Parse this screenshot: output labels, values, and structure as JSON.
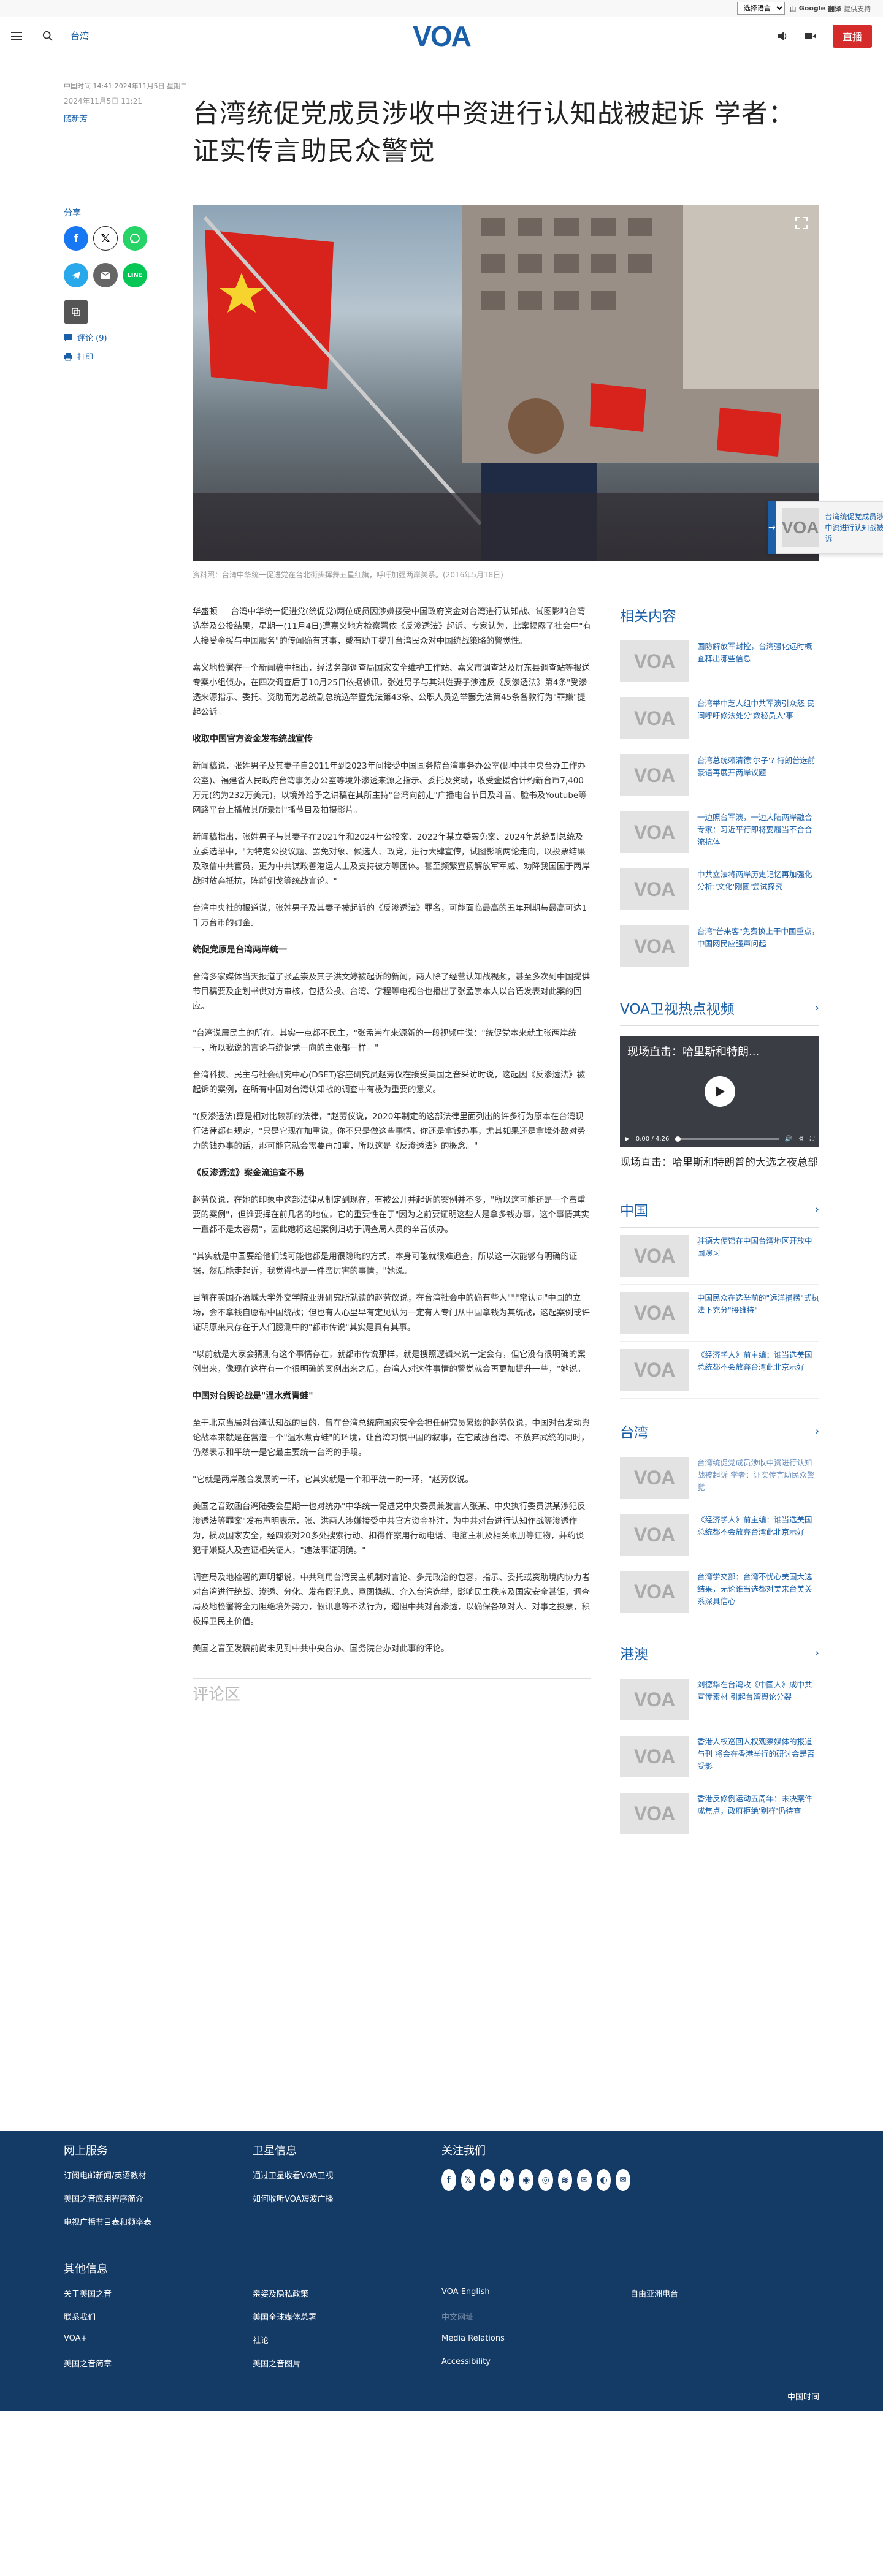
{
  "translate": {
    "select_label": "选择语言",
    "powered_by": "由",
    "google": "Google",
    "translate": "翻译",
    "provided": "提供支持"
  },
  "header": {
    "section_link": "台湾",
    "logo": "VOA",
    "live_label": "直播"
  },
  "article": {
    "meta_top": "中国时间 14:41 2024年11月5日 星期二",
    "date_small": "2024年11月5日 11:21",
    "author": "随新芳",
    "title": "台湾统促党成员涉收中资进行认知战被起诉 学者：证实传言助民众警觉",
    "caption": "资料照：台湾中华统一促进党在台北街头挥舞五星红旗，呼吁加强两岸关系。(2016年5月18日)",
    "paragraphs": [
      "华盛顿 — 台湾中华统一促进党(统促党)两位成员因涉嫌接受中国政府资金对台湾进行认知战、试图影响台湾选举及公投结果，星期一(11月4日)遭嘉义地方检察署依《反渗透法》起诉。专家认为，此案揭露了社会中\"有人接受金援与中国服务\"的传闻确有其事，或有助于提升台湾民众对中国统战策略的警觉性。",
      "嘉义地检署在一个新闻稿中指出，经法务部调查局国家安全维护工作站、嘉义市调查站及屏东县调查站等报送专案小组侦办，在四次调查后于10月25日依据侦讯，张姓男子与其洪姓妻子涉违反《反渗透法》第4条\"受渗透来源指示、委托、资助而为总统副总统选举暨免法第43条、公职人员选举罢免法第45条各款行为\"罪嫌\"提起公诉。"
    ],
    "h1": "收取中国官方资金发布统战宣传",
    "section1": [
      "新闻稿说，张姓男子及其妻子自2011年到2023年间接受中国国务院台湾事务办公室(即中共中央台办工作办公室)、福建省人民政府台湾事务办公室等境外渗透来源之指示、委托及资助，收受金援合计约新台币7,400万元(约为232万美元)，以境外给予之讲稿在其所主持\"台湾向前走\"广播电台节目及斗音、脸书及Youtube等网路平台上播放其所录制\"播节目及拍摄影片。",
      "新闻稿指出，张姓男子与其妻子在2021年和2024年公投案、2022年某立委罢免案、2024年总统副总统及立委选举中，\"为特定公投议题、罢免对象、候选人、政党，进行大肆宣传，试图影响两论走向，以投票结果及取信中共官员，更为中共谋政善港运人士及支持彼方等团体。甚至频繁宣扬解放军军威、劝降我国国于两岸战时放弃抵抗，阵前倒戈等统战言论。\"",
      "台湾中央社的报道说，张姓男子及其妻子被起诉的《反渗透法》罪名，可能面临最高的五年刑期与最高可达1千万台币的罚金。"
    ],
    "h2": "统促党原是台湾两岸统一",
    "section2": [
      "台湾多家媒体当天报道了张孟崇及其子洪文婷被起诉的新闻，两人除了经营认知战视频，甚至多次到中国提供节目稿要及企划书供对方审核，包括公投、台湾、学程等电视台也播出了张孟崇本人以台语发表对此案的回应。",
      "\"台湾说居民主的所在。其实一点都不民主，\"张孟崇在来源新的一段视频中说：\"统促党本来就主张两岸统一，所以我说的言论与统促党一向的主张都一样。\"",
      "台湾科技、民主与社会研究中心(DSET)客座研究员赵劳仪在接受美国之音采访时说，这起因《反渗透法》被起诉的案例，在所有中国对台湾认知战的调查中有极为重要的意义。",
      "\"(反渗透法)算是相对比较新的法律，\"赵劳仪说，2020年制定的这部法律里面列出的许多行为原本在台湾现行法律都有规定，\"只是它现在加重说，你不只是做这些事情，你还是拿钱办事，尤其如果还是拿境外敌对势力的钱办事的话，那可能它就会需要再加重，所以这是《反渗透法》的概念。\""
    ],
    "h3": "《反渗透法》案金流追查不易",
    "section3": [
      "赵劳仪说，在她的印象中这部法律从制定到现在，有被公开并起诉的案例并不多，\"所以这可能还是一个蛮重要的案例\"，但谁要挥在前几名的地位，它的重要性在于\"因为之前要证明这些人是拿多钱办事，这个事情其实一直都不是太容易\"，因此她将这起案例归功于调查局人员的辛苦侦办。",
      "\"其实就是中国要给他们钱可能也都是用很隐晦的方式，本身可能就很难追查，所以这一次能够有明确的证据，然后能走起诉，我觉得也是一件蛮厉害的事情，\"她说。",
      "目前在美国乔治城大学外交学院亚洲研究所就读的赵劳仪说，在台湾社会中的确有些人\"非常认同\"中国的立场，会不拿钱自愿帮中国统战；但也有人心里早有定见认为一定有人专门从中国拿钱为其统战，这起案例或许证明原来只存在于人们臆测中的\"都市传说\"其实是真有其事。",
      "\"以前就是大家会猜测有这个事情存在，就都市传说那样，就是搜照逻辑来说一定会有，但它没有很明确的案例出来，像现在这样有一个很明确的案例出来之后，台湾人对这件事情的警觉就会再更加提升一些，\"她说。"
    ],
    "h4": "中国对台舆论战是\"温水煮青蛙\"",
    "section4": [
      "至于北京当局对台湾认知战的目的，曾在台湾总统府国家安全会担任研究员暑缀的赵劳仪说，中国对台发动舆论战本来就是在营造一个\"温水煮青蛙\"的环境，让台湾习惯中国的叙事，在它咸胁台湾、不放弃武统的同时，仍然表示和平统一是它最主要统一台湾的手段。",
      "\"它就是两岸融合发展的一环，它其实就是一个和平统一的一环，\"赵劳仪说。",
      "美国之音致函台湾陆委会星期一也对统办\"中华统一促进党中央委员兼发言人张某、中央执行委员洪某涉犯反渗透法等罪案\"发布声明表示，张、洪两人涉嫌接受中共官方资金补注，为中共对台进行认知作战等渗透作为，损及国家安全，经四波对20多处搜索行动、扣得作案用行动电话、电脑主机及相关帐册等证物，并约谈犯罪嫌疑人及查证相关证人，\"违法事证明确。\"",
      "调查局及地检署的声明都说，中共利用台湾民主机制对言论、多元政治的包容，指示、委托或资助境内协力者对台湾进行统战、渗透、分化、发布假讯息，意图操纵、介入台湾选举，影响民主秩序及国家安全甚钜，调查局及地检署将全力阻绝境外势力，假讯息等不法行为，遏阻中共对台渗透，以确保各项对人、对事之投票，积极捍卫民主价值。",
      "美国之音至发稿前尚未见到中共中央台办、国务院台办对此事的评论。"
    ],
    "comments_heading": "评论区"
  },
  "share": {
    "title": "分享",
    "comments_link": "评论 (9)",
    "print_link": "打印"
  },
  "float_card": {
    "text": "台湾统促党成员涉收中资进行认知战被起诉"
  },
  "sidebar": {
    "related": {
      "title": "相关内容",
      "items": [
        "国防解放军封控，台湾强化远时概查释出哪些信息",
        "台湾举中芝人组中共军演引众怒 民间呼吁修法处分'数秘员人'事",
        "台湾总统赖清德'尔子'? 特朗普选前豪语再展开两岸议题",
        "一边照台军演，一边大陆两岸融合 专家：习近平行即将要履当不合合流抗体",
        "中共立法将两岸历史记忆再加强化 分析:'文化'刚固'尝试探究",
        "台湾\"普来客\"免费换上干中国重点，中国网民应强声问起"
      ]
    },
    "video": {
      "title": "VOA卫视热点视频",
      "overlay": "现场直击：哈里斯和特朗...",
      "time": "0:00 / 4:26",
      "caption": "现场直击：哈里斯和特朗普的大选之夜总部"
    },
    "china": {
      "title": "中国",
      "items": [
        "驻德大使馆在中国台湾地区开放中国演习",
        "中国民众在选举前的\"远洋捕捞\"式执法下充分\"接维持\"",
        "《经济学人》前主编：谁当选美国总统都不会放弃台湾此北京示好"
      ]
    },
    "taiwan": {
      "title": "台湾",
      "items": [
        "台湾统促党成员涉收中资进行认知战被起诉 学者：证实传言助民众警觉",
        "《经济学人》前主编：谁当选美国总统都不会放弃台湾此北京示好",
        "台湾学交部：台湾不忧心美国大选结果，无论谁当选都对美来台美关系深具信心"
      ]
    },
    "hongkong": {
      "title": "港澳",
      "items": [
        "刘德华在台湾收《中国人》成中共宣传素材 引起台湾舆论分裂",
        "香港人权巡回人权观察媒体的报道与刊 将会在香港举行的研讨会是否受影",
        "香港反修例运动五周年：未决案件成焦点，政府拒绝'别样'仍待查"
      ]
    }
  },
  "footer": {
    "col1": {
      "title": "网上服务",
      "links": [
        "订阅电邮新闻/英语教材",
        "美国之音应用程序简介",
        "电视广播节目表和频率表"
      ]
    },
    "col2": {
      "title": "卫星信息",
      "links": [
        "通过卫星收看VOA卫视",
        "如何收听VOA短波广播"
      ]
    },
    "col3": {
      "title": "关注我们"
    },
    "other_title": "其他信息",
    "other_links": [
      "关于美国之音",
      "亲姿及隐私政策",
      "VOA English",
      "自由亚洲电台",
      "联系我们",
      "美国全球媒体总署",
      "中文网址",
      "",
      "VOA+",
      "社论",
      "Media Relations",
      "",
      "美国之音简章",
      "美国之音图片",
      "Accessibility",
      ""
    ],
    "bottom_right": "中国时间"
  },
  "colors": {
    "brand_blue": "#1a5fa8",
    "live_red": "#d62b2b",
    "footer_bg": "#143a66"
  }
}
